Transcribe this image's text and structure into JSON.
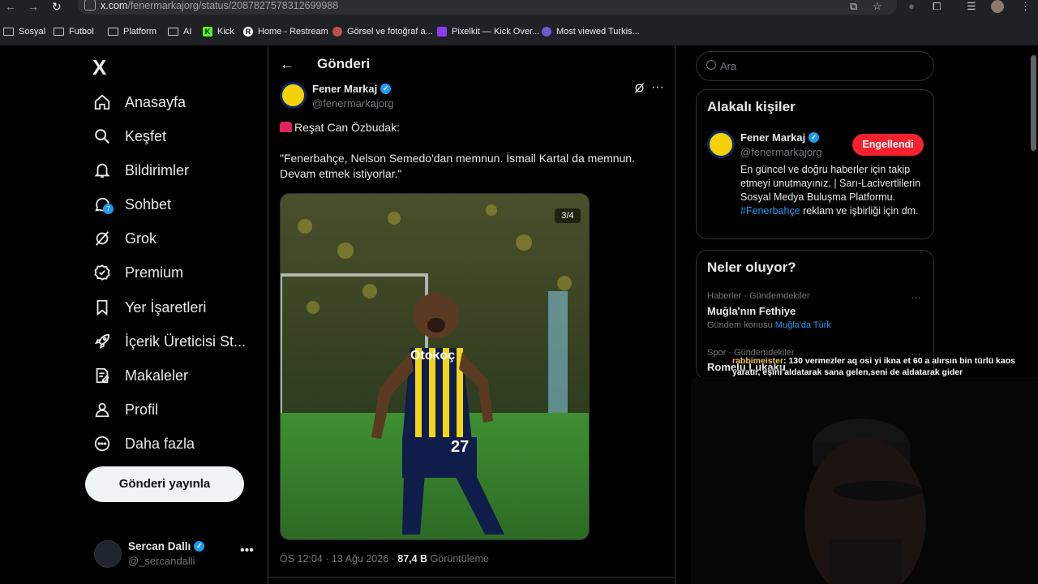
{
  "browser": {
    "url_host": "x.com",
    "url_path": "/fenermarkajorg/status/2087827578312699988",
    "bookmarks": [
      {
        "label": "Sosyal",
        "icon": "folder-icon"
      },
      {
        "label": "Futbol",
        "icon": "folder-icon"
      },
      {
        "label": "Platform",
        "icon": "folder-icon"
      },
      {
        "label": "AI",
        "icon": "folder-icon"
      },
      {
        "label": "Kick",
        "icon": "kick-icon"
      },
      {
        "label": "Home - Restream",
        "icon": "restream-icon"
      },
      {
        "label": "Görsel ve fotoğraf a...",
        "icon": "photo-site-icon"
      },
      {
        "label": "Pixelkit — Kick Over...",
        "icon": "pixelkit-icon"
      },
      {
        "label": "Most viewed Turkis...",
        "icon": "globe-icon"
      }
    ]
  },
  "sidebar": {
    "logo": "X",
    "items": [
      {
        "label": "Anasayfa",
        "icon": "home-icon"
      },
      {
        "label": "Keşfet",
        "icon": "search-icon"
      },
      {
        "label": "Bildirimler",
        "icon": "bell-icon"
      },
      {
        "label": "Sohbet",
        "icon": "chat-bubble-icon"
      },
      {
        "label": "Grok",
        "icon": "grok-icon"
      },
      {
        "label": "Premium",
        "icon": "verified-badge-icon"
      },
      {
        "label": "Yer İşaretleri",
        "icon": "bookmark-icon"
      },
      {
        "label": "İçerik Üreticisi St...",
        "icon": "rocket-icon"
      },
      {
        "label": "Makaleler",
        "icon": "article-icon"
      },
      {
        "label": "Profil",
        "icon": "person-icon"
      },
      {
        "label": "Daha fazla",
        "icon": "more-circle-icon"
      }
    ],
    "notification_count": "7",
    "post_button": "Gönderi yayınla",
    "account": {
      "name": "Sercan Dallı",
      "handle": "@_sercandalli"
    }
  },
  "main": {
    "header": "Gönderi",
    "post": {
      "author_name": "Fener Markaj",
      "author_handle": "@fenermarkajorg",
      "text_line1": "Reşat Can Özbudak:",
      "text_line2": "\"Fenerbahçe, Nelson Semedo'dan memnun. İsmail Kartal da memnun. Devam etmek istiyorlar.\"",
      "image_counter": "3/4",
      "jersey_sponsor": "Otokoç",
      "jersey_number": "27",
      "time": "ÖS 12:04 · 13 Ağu 2026 · ",
      "views_count": "87,4 B",
      "views_label": " Görüntüleme"
    }
  },
  "right": {
    "search_placeholder": "Ara",
    "related": {
      "title": "Alakalı kişiler",
      "name": "Fener Markaj",
      "handle": "@fenermarkajorg",
      "button": "Engellendi",
      "bio_before": "En güncel ve doğru haberler için takip etmeyi unutmayınız. | Sarı-Lacivertlilerin Sosyal Medya Buluşma Platformu. ",
      "bio_hashtag": "#Fenerbahçe",
      "bio_after": " reklam ve işbirliği için dm."
    },
    "trends": {
      "title": "Neler oluyor?",
      "items": [
        {
          "meta": "Haberler · Gündemdekiler",
          "title": "Muğla'nın Fethiye",
          "sub": "Gündem konusu ",
          "sub_link": "Muğla'da Türk"
        },
        {
          "meta": "Spor · Gündemdekiler",
          "title": "Romelu Lukaku"
        }
      ]
    }
  },
  "overlay": {
    "chat_user": "rabbimeister",
    "chat_message": ": 130 vermezler aq osi yi ikna et 60 a alırsın bin türlü kaos yaratır, eşini aldatarak sana gelen,seni de aldatarak gider"
  },
  "colors": {
    "accent": "#1d9bf0",
    "danger": "#f4212e",
    "background": "#000000",
    "border": "#2f3336"
  }
}
